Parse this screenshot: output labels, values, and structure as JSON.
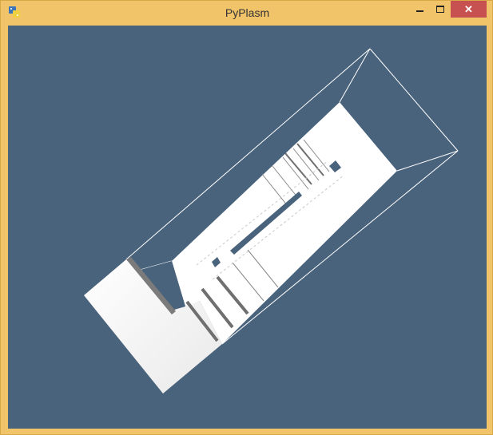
{
  "window": {
    "title": "PyPlasm",
    "app_icon": "python-icon",
    "controls": {
      "minimize": "minimize-icon",
      "maximize": "maximize-icon",
      "close": "close-icon"
    }
  },
  "viewport": {
    "background_color": "#4a637c",
    "model_color": "#ffffff"
  }
}
